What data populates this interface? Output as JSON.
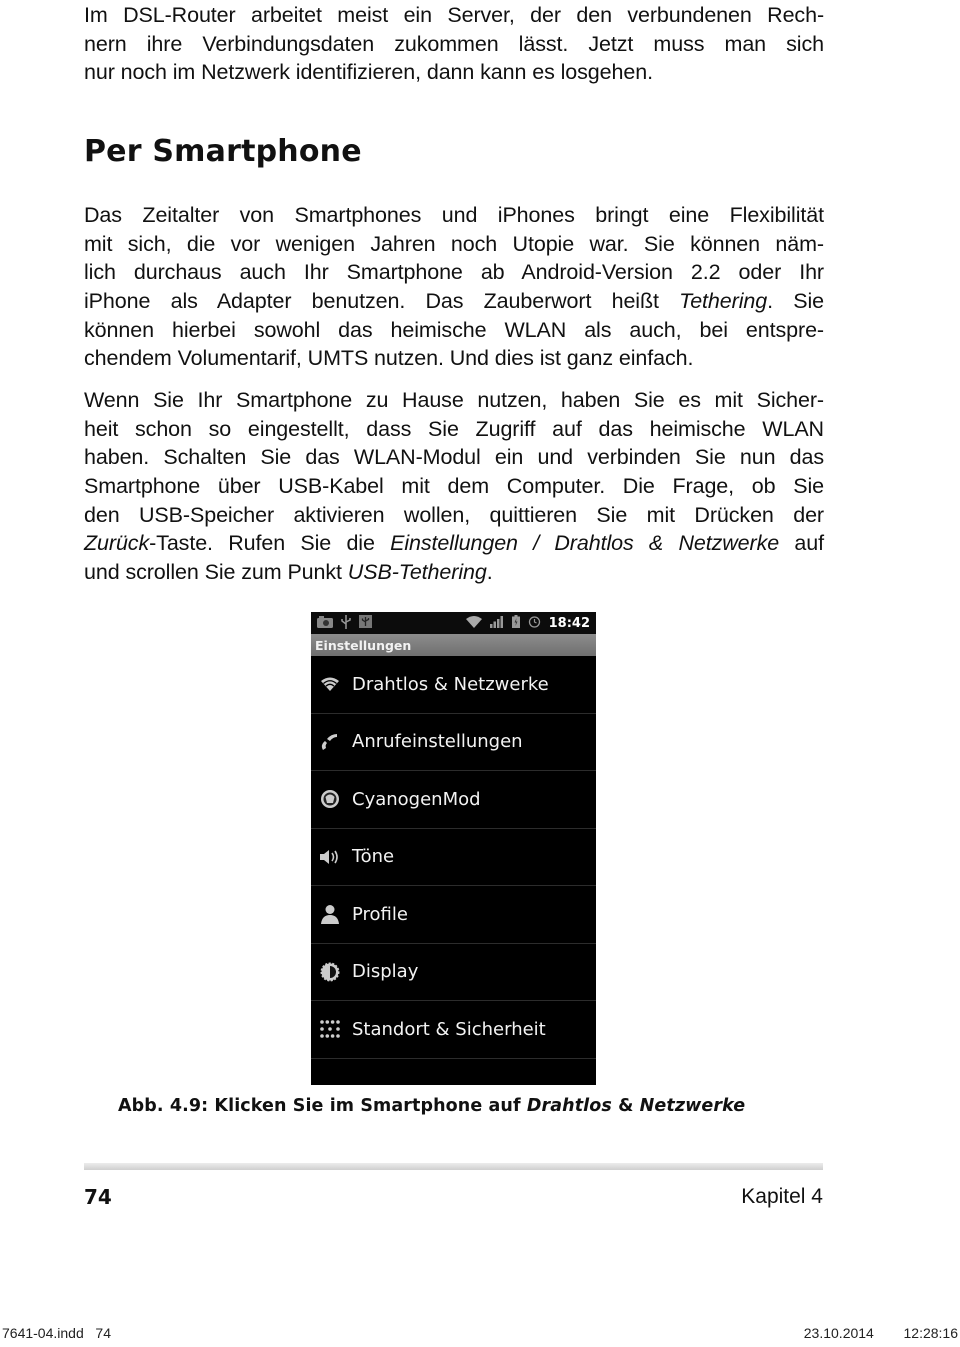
{
  "intro_paragraph": {
    "lines": [
      "Im DSL-Router arbeitet meist ein Server, der den verbundenen Rech-",
      "nern ihre Verbindungsdaten zukommen lässt. Jetzt muss man sich",
      "nur noch im Netzwerk identifizieren, dann kann es losgehen."
    ]
  },
  "section_heading": "Per Smartphone",
  "paragraph1": {
    "line1": "Das Zeitalter von Smartphones und iPhones bringt eine Flexibilität",
    "line2": "mit sich, die vor wenigen Jahren noch Utopie war. Sie können näm-",
    "line3": "lich durchaus auch Ihr Smartphone ab Android-Version 2.2 oder Ihr",
    "line4_pre": "iPhone als Adapter benutzen. Das Zauberwort heißt ",
    "line4_em": "Tethering",
    "line4_post": ". Sie",
    "line5": "können hierbei sowohl das heimische WLAN als auch, bei entspre-",
    "line6": "chendem Volumentarif, UMTS nutzen. Und dies ist ganz einfach."
  },
  "paragraph2": {
    "line1": "Wenn Sie Ihr Smartphone zu Hause nutzen, haben Sie es mit Sicher-",
    "line2": "heit schon so eingestellt, dass Sie Zugriff auf das heimische WLAN",
    "line3": "haben. Schalten Sie das WLAN-Modul ein und verbinden Sie nun das",
    "line4": "Smartphone über USB-Kabel mit dem Computer. Die Frage, ob Sie",
    "line5": "den USB-Speicher aktivieren wollen, quittieren Sie mit Drücken der",
    "line6_em1": "Zurück",
    "line6_mid1": "-Taste. Rufen Sie die ",
    "line6_em2": "Einstellungen / Drahtlos & Netzwerke",
    "line6_post": " auf",
    "line7_pre": "und scrollen Sie zum Punkt ",
    "line7_em": "USB-Tethering",
    "line7_post": "."
  },
  "phone": {
    "status_bar": {
      "left_icons": [
        "camera-icon",
        "usb-icon",
        "usb-debug-icon"
      ],
      "right_icons": [
        "wifi-icon",
        "signal-icon",
        "battery-icon",
        "alarm-icon"
      ],
      "time": "18:42"
    },
    "title": "Einstellungen",
    "menu_items": [
      {
        "label": "Drahtlos & Netzwerke",
        "icon": "wifi-icon"
      },
      {
        "label": "Anrufeinstellungen",
        "icon": "phone-icon"
      },
      {
        "label": "CyanogenMod",
        "icon": "cyanogenmod-icon"
      },
      {
        "label": "Töne",
        "icon": "speaker-icon"
      },
      {
        "label": "Profile",
        "icon": "person-icon"
      },
      {
        "label": "Display",
        "icon": "brightness-icon"
      },
      {
        "label": "Standort & Sicherheit",
        "icon": "location-grid-icon"
      },
      {
        "label": "",
        "icon": "apps-icon"
      }
    ]
  },
  "caption": {
    "prefix": "Abb. 4.9: Klicken Sie im Smartphone auf ",
    "em1": "Drahtlos",
    "mid": " & ",
    "em2": "Netzwerke"
  },
  "footer": {
    "page_number": "74",
    "chapter": "Kapitel 4"
  },
  "print_slug": {
    "file": "7641-04.indd   74",
    "timestamp": "23.10.2014   12:28:16"
  }
}
